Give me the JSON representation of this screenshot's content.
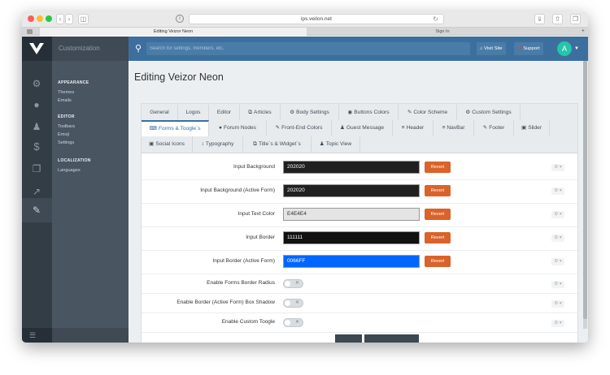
{
  "browser": {
    "url": "ips.veilon.net",
    "tabs": [
      "Editing Veizor Neon",
      "Sign In"
    ]
  },
  "app": {
    "section_title": "Customization",
    "search_placeholder": "Search for settings, members, etc.",
    "visit_site": "Visit Site",
    "support": "Support",
    "avatar_letter": "A"
  },
  "subnav": {
    "appearance": {
      "title": "APPEARANCE",
      "items": [
        "Themes",
        "Emails"
      ]
    },
    "editor": {
      "title": "EDITOR",
      "items": [
        "Toolbars",
        "Emoji",
        "Settings"
      ]
    },
    "localization": {
      "title": "LOCALIZATION",
      "items": [
        "Languages"
      ]
    }
  },
  "page": {
    "title": "Editing Veizor Neon"
  },
  "tabs": {
    "row1": [
      "General",
      "Logos",
      "Editor",
      "Articles",
      "Body Settings",
      "Buttons Colors",
      "Color Scheme",
      "Custom Settings"
    ],
    "row2": [
      "Forms & Toogle`s",
      "Forum Nodes",
      "Front-End Colors",
      "Guest Message",
      "Header",
      "NavBar",
      "Footer",
      "Slider"
    ],
    "row3": [
      "Social Icons",
      "Typography",
      "Title`s & Widget`s",
      "Topic View"
    ]
  },
  "settings": [
    {
      "label": "Input Background",
      "value": "202020",
      "bg": "#202020",
      "fg": "#ffffff"
    },
    {
      "label": "Input Background (Active Form)",
      "value": "202020",
      "bg": "#202020",
      "fg": "#ffffff"
    },
    {
      "label": "Input Text Color",
      "value": "E4E4E4",
      "bg": "#e4e4e4",
      "fg": "#333333"
    },
    {
      "label": "Input Border",
      "value": "111111",
      "bg": "#111111",
      "fg": "#ffffff"
    },
    {
      "label": "Input Border (Active Form)",
      "value": "0066FF",
      "bg": "#0066ff",
      "fg": "#ffffff"
    }
  ],
  "revert_label": "Revert",
  "toggles": [
    {
      "label": "Enable Forms Border Radius",
      "on": false
    },
    {
      "label": "Enable Border (Active Form) Box Shadow",
      "on": false
    },
    {
      "label": "Enable Custom Toogle",
      "on": false
    }
  ],
  "colors": {
    "accent": "#3c6f9d",
    "revert": "#d9632a",
    "sidebar": "#333d46"
  }
}
